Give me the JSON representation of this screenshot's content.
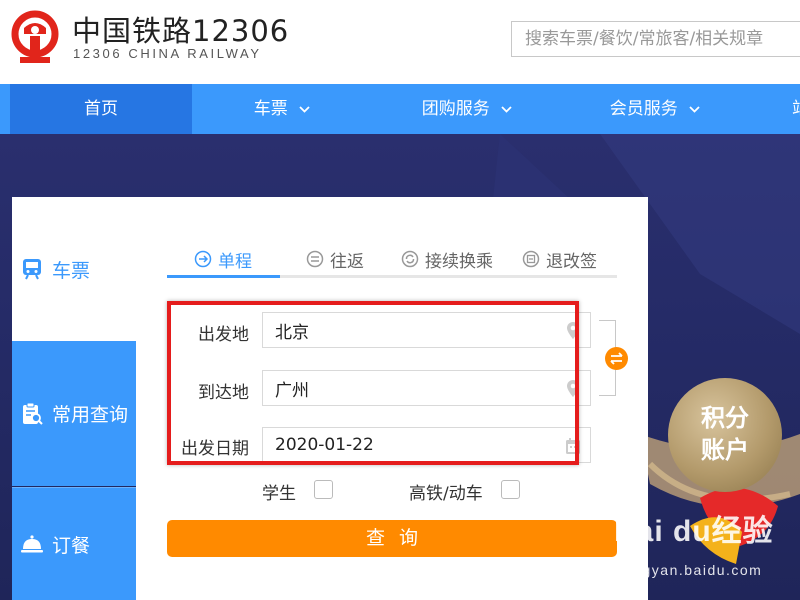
{
  "header": {
    "logo_cn": "中国铁路12306",
    "logo_en": "12306 CHINA RAILWAY",
    "search_placeholder": "搜索车票/餐饮/常旅客/相关规章",
    "brand_color": "#e1251b"
  },
  "nav": {
    "items": [
      {
        "label": "首页",
        "active": true
      },
      {
        "label": "车票",
        "dropdown": true
      },
      {
        "label": "团购服务",
        "dropdown": true
      },
      {
        "label": "会员服务",
        "dropdown": true
      },
      {
        "label": "站"
      }
    ],
    "color": "#3b99fc",
    "active_color": "#2676e3"
  },
  "side_tabs": [
    {
      "label": "车票",
      "icon": "train-icon",
      "active": true
    },
    {
      "label": "常用查询",
      "icon": "clipboard-search-icon"
    },
    {
      "label": "订餐",
      "icon": "food-cloche-icon"
    }
  ],
  "ticket_types": [
    {
      "label": "单程",
      "icon": "arrow-right-circle-icon",
      "active": true
    },
    {
      "label": "往返",
      "icon": "round-trip-circle-icon"
    },
    {
      "label": "接续换乘",
      "icon": "transfer-circle-icon"
    },
    {
      "label": "退改签",
      "icon": "refund-circle-icon"
    }
  ],
  "form": {
    "from_label": "出发地",
    "from_value": "北京",
    "to_label": "到达地",
    "to_value": "广州",
    "date_label": "出发日期",
    "date_value": "2020-01-22",
    "student_label": "学生",
    "gaotie_label": "高铁/动车",
    "query_label": "查询"
  },
  "points_badge": {
    "line1": "积分",
    "line2": "账户"
  },
  "watermark": {
    "main": "Bai du经验",
    "sub": "jingyan.baidu.com"
  },
  "colors": {
    "accent_orange": "#ff8a00",
    "highlight_red": "#e51c1c"
  }
}
